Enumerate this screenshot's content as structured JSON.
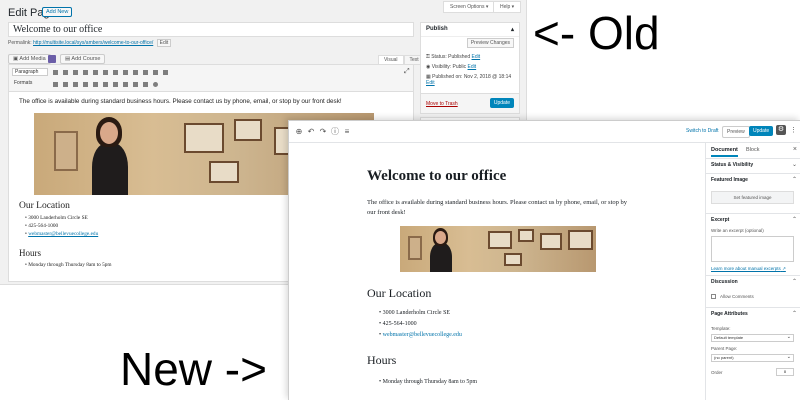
{
  "annotations": {
    "old": "<- Old",
    "new": "New ->"
  },
  "old_editor": {
    "heading": "Edit Page",
    "add_new": "Add New",
    "screen_options": "Screen Options ▾",
    "help": "Help ▾",
    "title_value": "Welcome to our office",
    "permalink_label": "Permalink:",
    "permalink_url": "http://multisite.local/sys/ambers/welcome-to-our-office/",
    "permalink_edit": "Edit",
    "add_media": "Add Media",
    "add_course": "Add Course",
    "tab_visual": "Visual",
    "tab_text": "Text",
    "toolbar_format": "Paragraph",
    "toolbar_formats": "Formats",
    "body_text": "The office is available during standard business hours. Please contact us by phone, email, or stop by our front desk!",
    "location_heading": "Our Location",
    "location_items": [
      "3000 Landerholm Circle SE",
      "425-564-1000",
      "webmaster@bellevuecollege.edu"
    ],
    "hours_heading": "Hours",
    "hours_items": [
      "Monday through Thursday 8am to 5pm"
    ],
    "publish": {
      "title": "Publish",
      "preview_changes": "Preview Changes",
      "status": "Status: Published",
      "visibility": "Visibility: Public",
      "published_on": "Published on: Nov 2, 2018 @ 18:14",
      "edit": "Edit",
      "move_to_trash": "Move to Trash",
      "update": "Update"
    }
  },
  "new_editor": {
    "switch_to_draft": "Switch to Draft",
    "preview": "Preview",
    "update": "Update",
    "title": "Welcome to our office",
    "body_text": "The office is available during standard business hours. Please contact us by phone, email, or stop by our front desk!",
    "location_heading": "Our Location",
    "location_items": [
      "3000 Landerholm Circle SE",
      "425-564-1000",
      "webmaster@bellevuecollege.edu"
    ],
    "hours_heading": "Hours",
    "hours_items": [
      "Monday through Thursday 8am to 5pm"
    ],
    "sidebar": {
      "tab_document": "Document",
      "tab_block": "Block",
      "status_visibility": "Status & Visibility",
      "featured_image": "Featured Image",
      "set_featured_image": "Set featured image",
      "excerpt": "Excerpt",
      "excerpt_label": "Write an excerpt (optional)",
      "excerpt_link": "Learn more about manual excerpts",
      "discussion": "Discussion",
      "allow_comments": "Allow Comments",
      "page_attributes": "Page Attributes",
      "template_label": "Template:",
      "template_value": "Default template",
      "parent_label": "Parent Page:",
      "parent_value": "(no parent)",
      "order_label": "Order",
      "order_value": "0"
    }
  }
}
